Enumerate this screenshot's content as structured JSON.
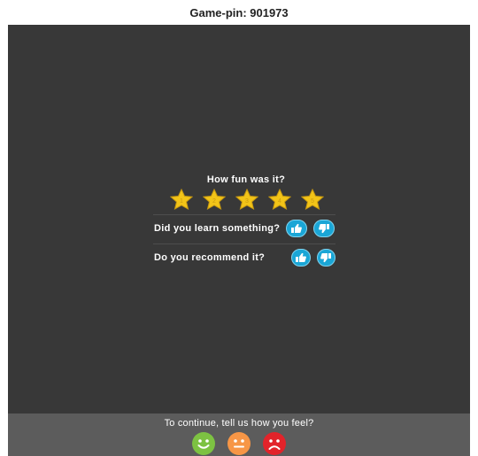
{
  "header": {
    "game_pin": "Game-pin: 901973"
  },
  "feedback": {
    "fun_question": "How fun was it?",
    "stars": [
      {
        "label": "1"
      },
      {
        "label": "2"
      },
      {
        "label": "3"
      },
      {
        "label": "4"
      },
      {
        "label": "5"
      }
    ],
    "learn_question": "Did you learn something?",
    "recommend_question": "Do you recommend it?",
    "thumb_up_icon": "thumbs-up-icon",
    "thumb_down_icon": "thumbs-down-icon"
  },
  "footer": {
    "continue_text": "To continue, tell us how you feel?",
    "faces": [
      {
        "mood": "happy",
        "color": "#7dc242"
      },
      {
        "mood": "neutral",
        "color": "#f79646"
      },
      {
        "mood": "sad",
        "color": "#e2232a"
      }
    ]
  },
  "colors": {
    "background": "#383838",
    "footer": "#5c5c5c",
    "star": "#f2c418",
    "thumb_button": "#1aa6d6"
  }
}
